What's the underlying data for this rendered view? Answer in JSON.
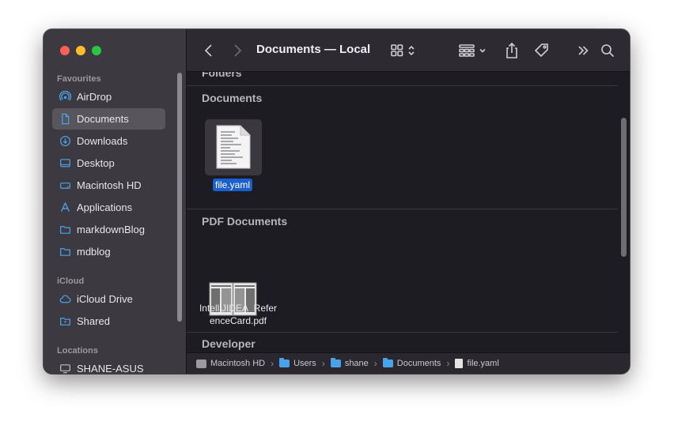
{
  "window": {
    "title": "Documents — Local"
  },
  "sidebar": {
    "sections": [
      {
        "label": "Favourites"
      },
      {
        "label": "iCloud"
      },
      {
        "label": "Locations"
      }
    ],
    "items": [
      {
        "label": "AirDrop",
        "icon": "airdrop-icon"
      },
      {
        "label": "Documents",
        "icon": "document-icon"
      },
      {
        "label": "Downloads",
        "icon": "download-icon"
      },
      {
        "label": "Desktop",
        "icon": "desktop-icon"
      },
      {
        "label": "Macintosh HD",
        "icon": "disk-icon"
      },
      {
        "label": "Applications",
        "icon": "applications-icon"
      },
      {
        "label": "markdownBlog",
        "icon": "folder-icon"
      },
      {
        "label": "mdblog",
        "icon": "folder-icon"
      },
      {
        "label": "iCloud Drive",
        "icon": "cloud-icon"
      },
      {
        "label": "Shared",
        "icon": "shared-folder-icon"
      },
      {
        "label": "SHANE-ASUS",
        "icon": "computer-icon"
      }
    ]
  },
  "content": {
    "groups": [
      {
        "label": "Folders"
      },
      {
        "label": "Documents"
      },
      {
        "label": "PDF Documents"
      },
      {
        "label": "Developer"
      }
    ],
    "files": [
      {
        "name": "file.yaml",
        "selected": true
      },
      {
        "name": "IntelliJIDEA_Refer",
        "name_line2": "enceCard.pdf"
      }
    ]
  },
  "pathbar": {
    "items": [
      "Macintosh HD",
      "Users",
      "shane",
      "Documents",
      "file.yaml"
    ],
    "separator": "›"
  },
  "colors": {
    "selection": "#1a5fd0",
    "folder": "#4aa3e8",
    "close": "#fe5f57",
    "minimize": "#febc2e",
    "zoom": "#28c840"
  }
}
